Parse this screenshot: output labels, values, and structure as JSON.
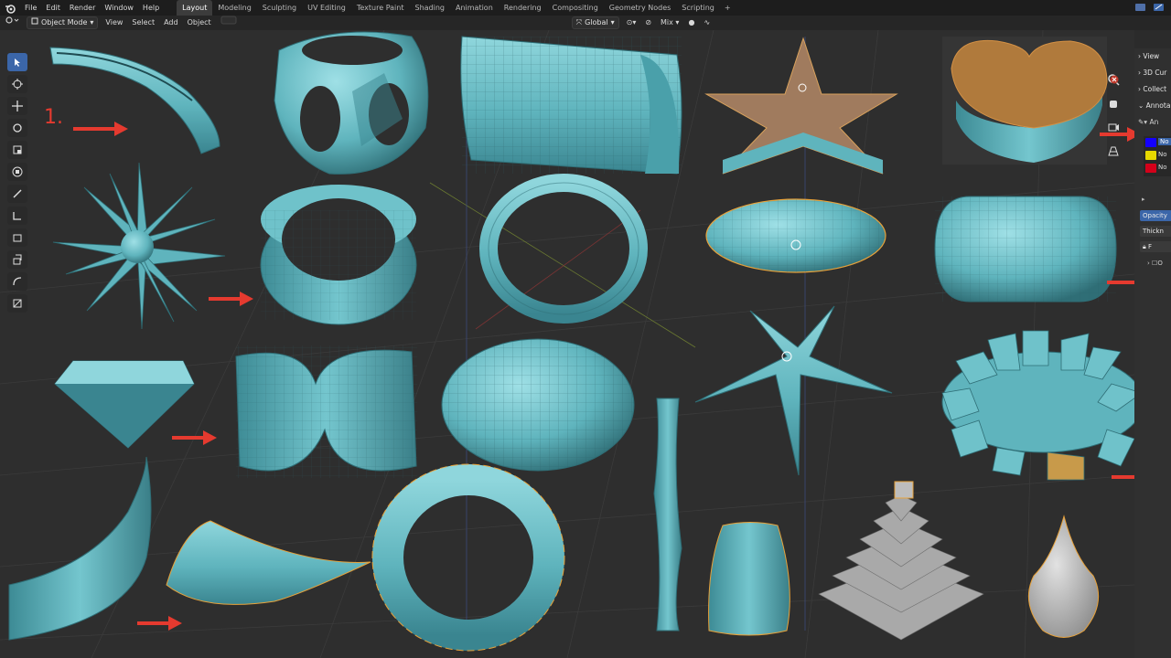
{
  "menubar": {
    "items": [
      "File",
      "Edit",
      "Render",
      "Window",
      "Help"
    ],
    "workspaces": [
      "Layout",
      "Modeling",
      "Sculpting",
      "UV Editing",
      "Texture Paint",
      "Shading",
      "Animation",
      "Rendering",
      "Compositing",
      "Geometry Nodes",
      "Scripting"
    ],
    "active_workspace": "Layout",
    "add_tab": "+"
  },
  "toolbar": {
    "mode": "Object Mode",
    "menus": [
      "View",
      "Select",
      "Add",
      "Object"
    ],
    "transform_orientation": "Global",
    "snap_mode": "Mix"
  },
  "npanel": {
    "sections": [
      "View",
      "3D Cur",
      "Collect",
      "Annota"
    ],
    "layer_names": [
      "No",
      "No",
      "No"
    ],
    "layer_colors": [
      "#1400ff",
      "#e6d800",
      "#d4001a"
    ],
    "opacity_label": "Opacity",
    "thickness_label": "Thickn",
    "lock_label": "F",
    "collapsed_label": "O",
    "layer_dropdown": "An"
  },
  "annotation": {
    "step_label": "1."
  },
  "colors": {
    "mesh": "#5fb4bd",
    "mesh_dark": "#2f6e76",
    "arrow": "#e53a2f",
    "selection": "#e8a23a",
    "grid": "#3a3a3a"
  }
}
